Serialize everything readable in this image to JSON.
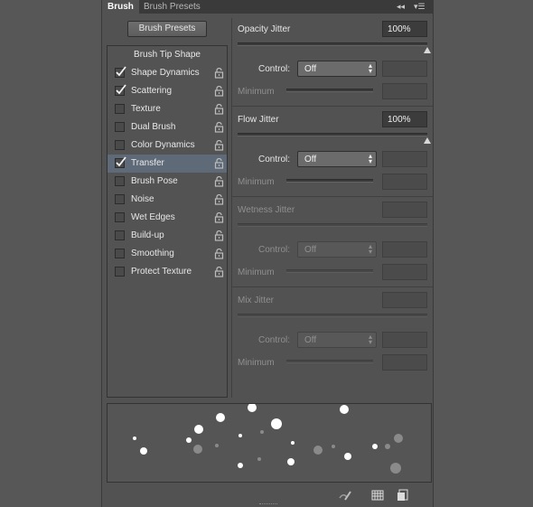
{
  "tabs": [
    {
      "label": "Brush",
      "active": true
    },
    {
      "label": "Brush Presets",
      "active": false
    }
  ],
  "tab_controls": {
    "collapse": "◂◂",
    "menu": "▾☰"
  },
  "brush_presets_button": "Brush Presets",
  "list_items": [
    {
      "label": "Brush Tip Shape",
      "checkbox": false,
      "checked": false,
      "lock": false,
      "selected": false
    },
    {
      "label": "Shape Dynamics",
      "checkbox": true,
      "checked": true,
      "lock": true,
      "selected": false
    },
    {
      "label": "Scattering",
      "checkbox": true,
      "checked": true,
      "lock": true,
      "selected": false
    },
    {
      "label": "Texture",
      "checkbox": true,
      "checked": false,
      "lock": true,
      "selected": false
    },
    {
      "label": "Dual Brush",
      "checkbox": true,
      "checked": false,
      "lock": true,
      "selected": false
    },
    {
      "label": "Color Dynamics",
      "checkbox": true,
      "checked": false,
      "lock": true,
      "selected": false
    },
    {
      "label": "Transfer",
      "checkbox": true,
      "checked": true,
      "lock": true,
      "selected": true
    },
    {
      "label": "Brush Pose",
      "checkbox": true,
      "checked": false,
      "lock": true,
      "selected": false
    },
    {
      "label": "Noise",
      "checkbox": true,
      "checked": false,
      "lock": true,
      "selected": false
    },
    {
      "label": "Wet Edges",
      "checkbox": true,
      "checked": false,
      "lock": true,
      "selected": false
    },
    {
      "label": "Build-up",
      "checkbox": true,
      "checked": false,
      "lock": true,
      "selected": false
    },
    {
      "label": "Smoothing",
      "checkbox": true,
      "checked": false,
      "lock": true,
      "selected": false
    },
    {
      "label": "Protect Texture",
      "checkbox": true,
      "checked": false,
      "lock": true,
      "selected": false
    }
  ],
  "opacity": {
    "label": "Opacity Jitter",
    "value": "100%",
    "control_label": "Control:",
    "control_value": "Off",
    "minimum_label": "Minimum",
    "level": 1.0
  },
  "flow": {
    "label": "Flow Jitter",
    "value": "100%",
    "control_label": "Control:",
    "control_value": "Off",
    "minimum_label": "Minimum",
    "level": 1.0
  },
  "wetness": {
    "label": "Wetness Jitter",
    "control_label": "Control:",
    "control_value": "Off",
    "minimum_label": "Minimum"
  },
  "mix": {
    "label": "Mix Jitter",
    "control_label": "Control:",
    "control_value": "Off",
    "minimum_label": "Minimum"
  },
  "bottom_icons": [
    "brush-toggle-icon",
    "grid-icon",
    "new-preset-icon"
  ],
  "colors": {
    "panel": "#525252",
    "selected_row": "#5f6a78",
    "text": "#dcdcdc",
    "dim_text": "#8f8f8f"
  }
}
